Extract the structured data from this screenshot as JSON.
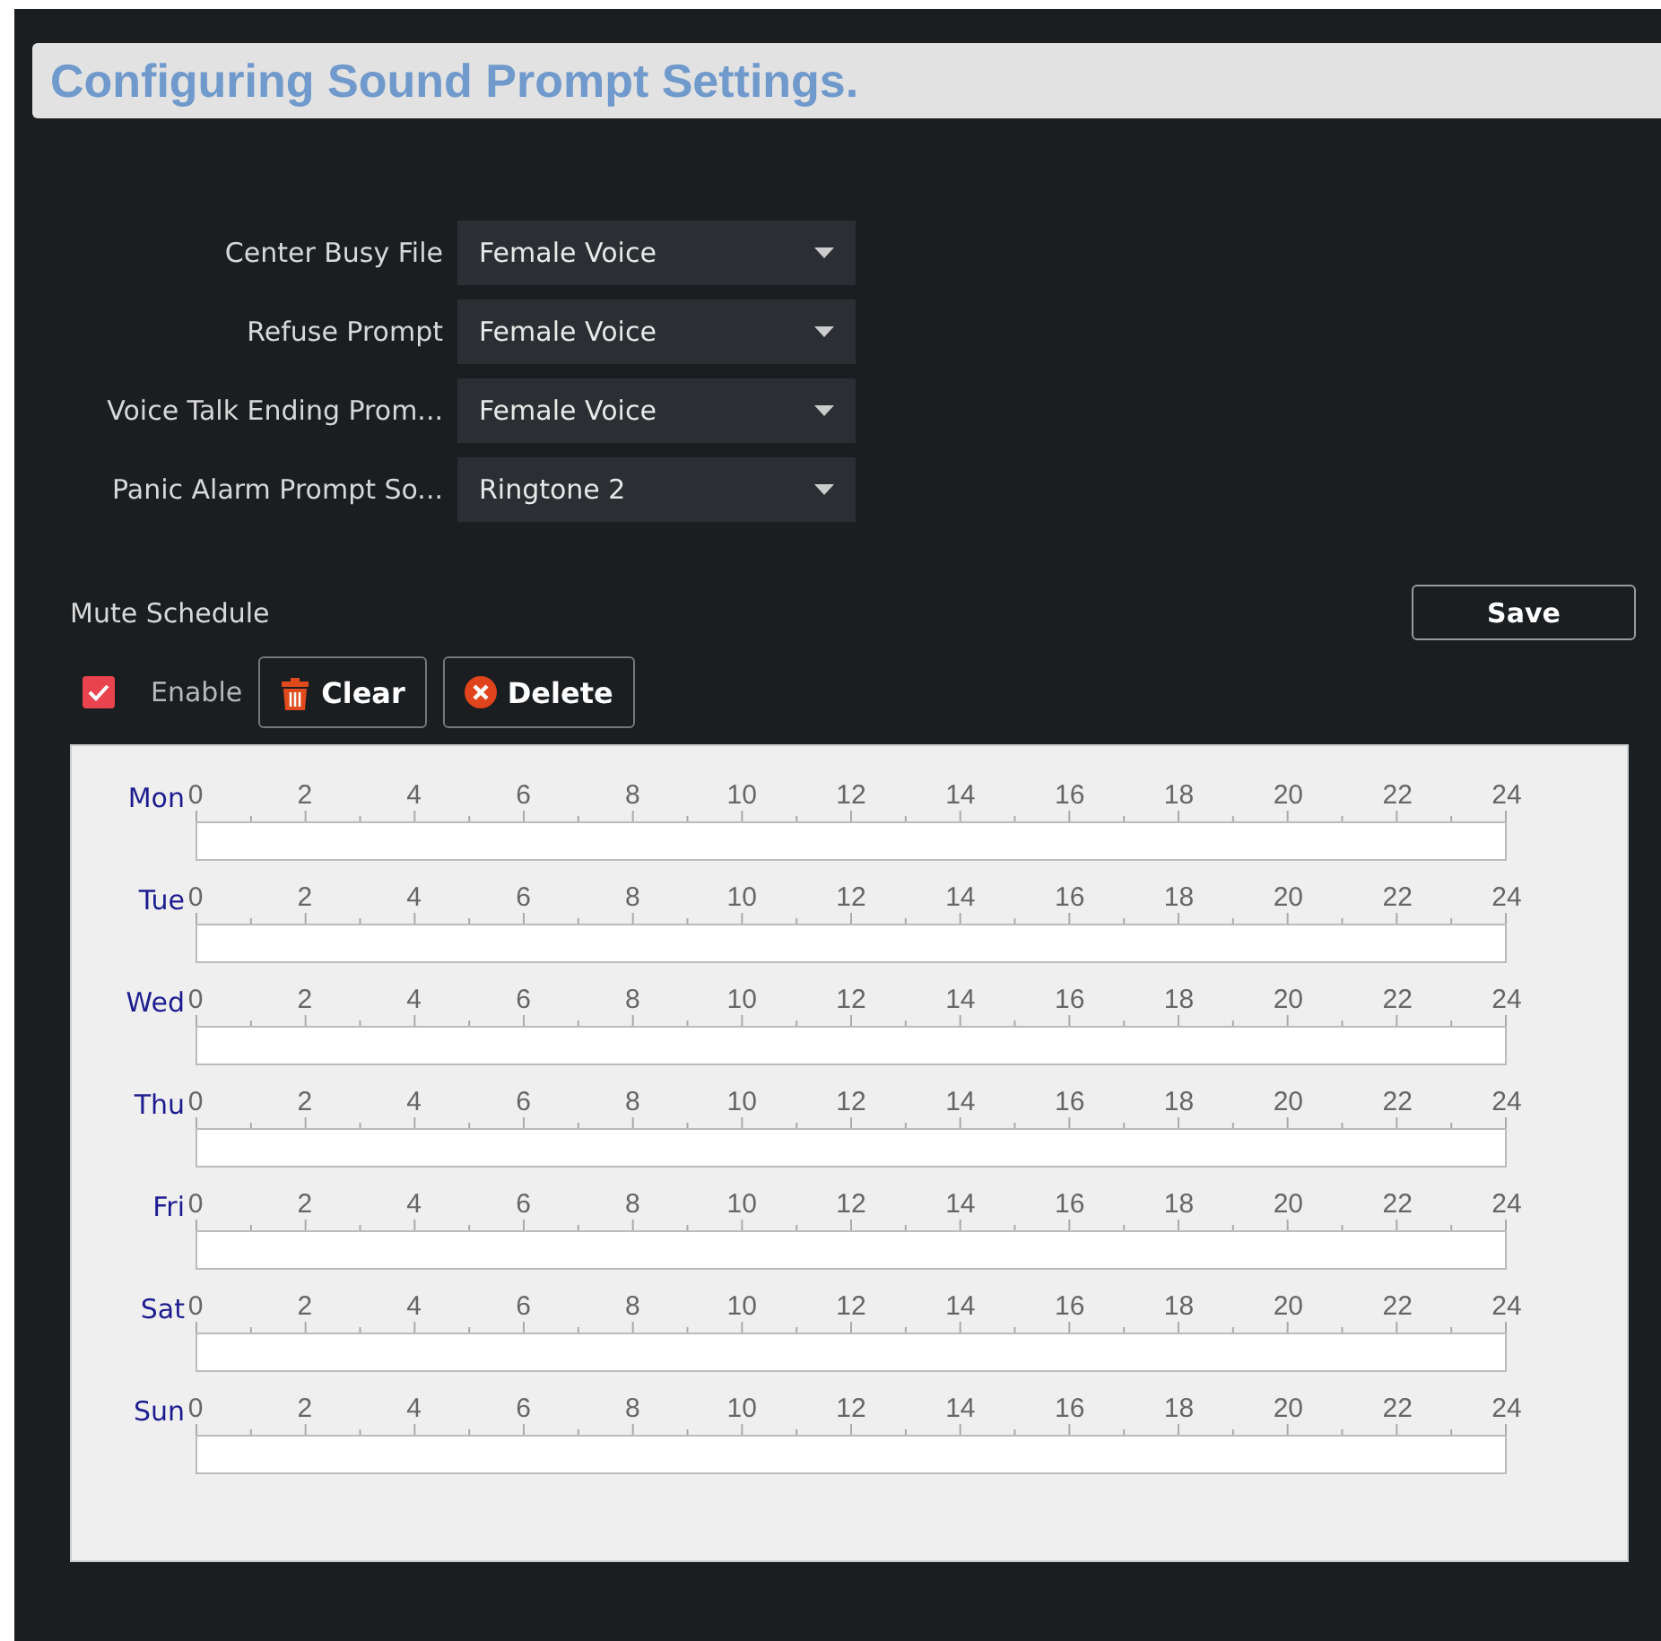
{
  "title": "Configuring Sound Prompt Settings.",
  "fields": [
    {
      "label": "Center Busy File",
      "value": "Female Voice"
    },
    {
      "label": "Refuse Prompt",
      "value": "Female Voice"
    },
    {
      "label": "Voice Talk Ending Prom...",
      "value": "Female Voice"
    },
    {
      "label": "Panic Alarm Prompt So...",
      "value": "Ringtone 2"
    }
  ],
  "mute_schedule": {
    "label": "Mute Schedule",
    "save": "Save",
    "enable": {
      "label": "Enable",
      "checked": true
    },
    "buttons": [
      {
        "label": "Clear",
        "kind": "clear"
      },
      {
        "label": "Delete",
        "kind": "delete"
      }
    ],
    "days": [
      {
        "day": "Mon",
        "scale": [
          "0",
          "2",
          "4",
          "6",
          "8",
          "10",
          "12",
          "14",
          "16",
          "18",
          "20",
          "22",
          "24"
        ]
      },
      {
        "day": "Tue",
        "scale": [
          "0",
          "2",
          "4",
          "6",
          "8",
          "10",
          "12",
          "14",
          "16",
          "18",
          "20",
          "22",
          "24"
        ]
      },
      {
        "day": "Wed",
        "scale": [
          "0",
          "2",
          "4",
          "6",
          "8",
          "10",
          "12",
          "14",
          "16",
          "18",
          "20",
          "22",
          "24"
        ]
      },
      {
        "day": "Thu",
        "scale": [
          "0",
          "2",
          "4",
          "6",
          "8",
          "10",
          "12",
          "14",
          "16",
          "18",
          "20",
          "22",
          "24"
        ]
      },
      {
        "day": "Fri",
        "scale": [
          "0",
          "2",
          "4",
          "6",
          "8",
          "10",
          "12",
          "14",
          "16",
          "18",
          "20",
          "22",
          "24"
        ]
      },
      {
        "day": "Sat",
        "scale": [
          "0",
          "2",
          "4",
          "6",
          "8",
          "10",
          "12",
          "14",
          "16",
          "18",
          "20",
          "22",
          "24"
        ]
      },
      {
        "day": "Sun",
        "scale": [
          "0",
          "2",
          "4",
          "6",
          "8",
          "10",
          "12",
          "14",
          "16",
          "18",
          "20",
          "22",
          "24"
        ]
      }
    ]
  }
}
